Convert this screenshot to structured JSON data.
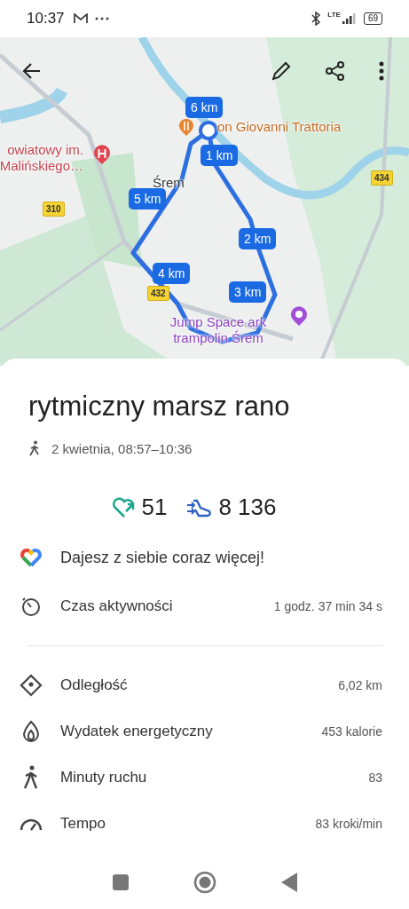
{
  "status_bar": {
    "time": "10:37",
    "network": "LTE",
    "battery": "69"
  },
  "map": {
    "places": [
      {
        "kind": "restaurant",
        "text": "on Giovanni Trattoria"
      },
      {
        "kind": "hospital",
        "text": "owiatowy im. Malińskiego…"
      },
      {
        "kind": "town",
        "text": "Śrem"
      },
      {
        "kind": "park",
        "text": "Jump Space ark trampolin Śrem"
      }
    ],
    "roads": [
      "310",
      "434",
      "432"
    ],
    "markers": [
      "6 km",
      "1 km",
      "5 km",
      "2 km",
      "4 km",
      "3 km"
    ]
  },
  "activity": {
    "title": "rytmiczny marsz rano",
    "date": "2 kwietnia, 08:57–10:36",
    "heart_points": "51",
    "steps": "8 136",
    "message": "Dajesz z siebie coraz więcej!"
  },
  "primary_metrics": [
    {
      "kind": "time",
      "label": "Czas aktywności",
      "value": "1 godz. 37 min 34 s"
    }
  ],
  "metrics": [
    {
      "kind": "distance",
      "label": "Odległość",
      "value": "6,02 km"
    },
    {
      "kind": "energy",
      "label": "Wydatek energetyczny",
      "value": "453 kalorie"
    },
    {
      "kind": "move",
      "label": "Minuty ruchu",
      "value": "83"
    },
    {
      "kind": "pace",
      "label": "Tempo",
      "value": "83 kroki/min"
    }
  ]
}
